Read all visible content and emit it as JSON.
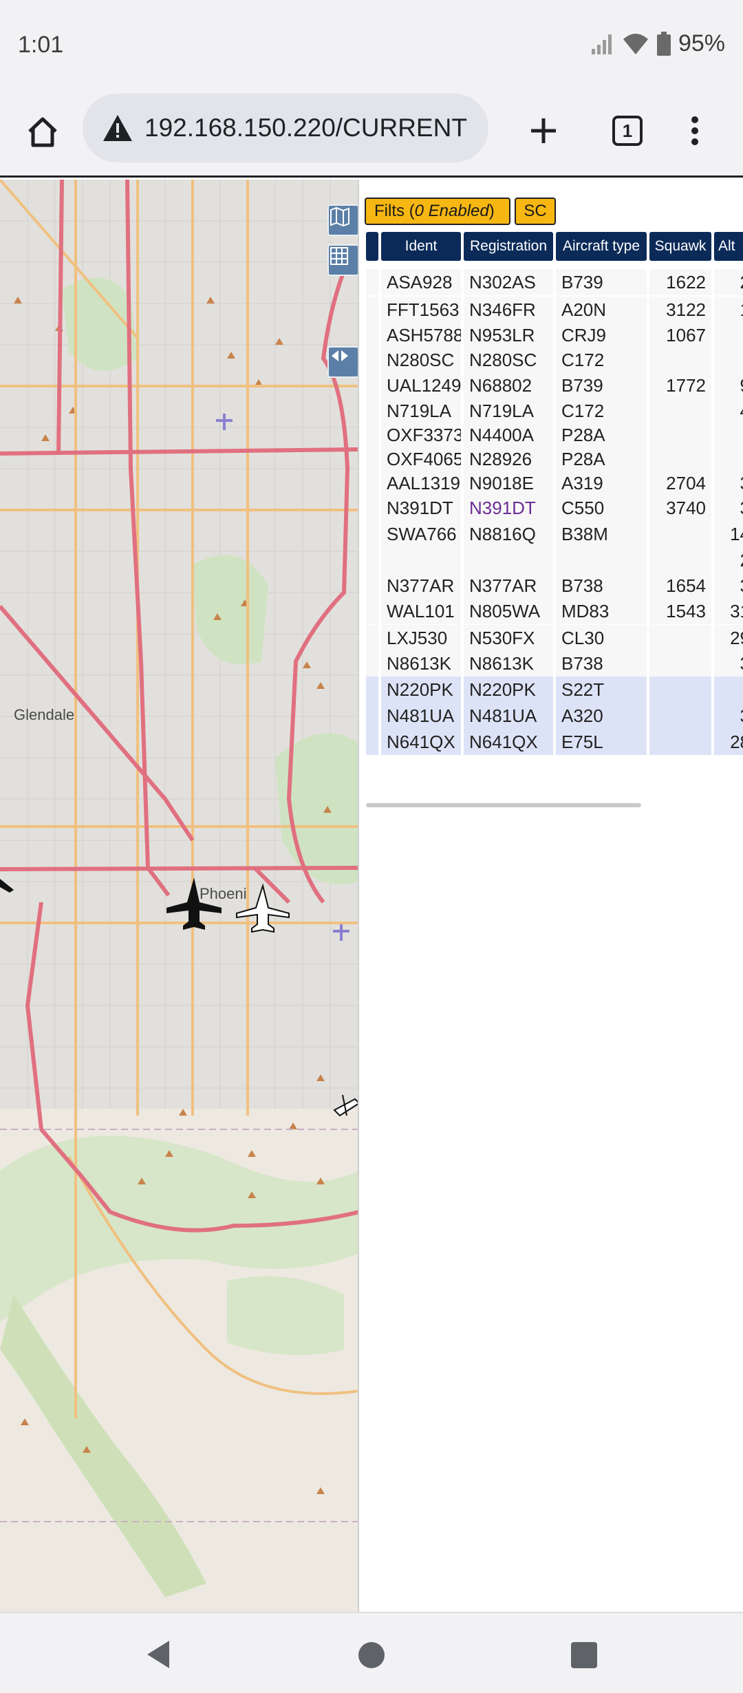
{
  "status": {
    "time": "1:01",
    "battery": "95%"
  },
  "browser": {
    "url": "192.168.150.220/CURRENT",
    "tab_count": "1"
  },
  "map": {
    "labels": {
      "glendale": "Glendale",
      "phoenix": "Phoeni"
    }
  },
  "filters": {
    "filter_label": "Filts (",
    "filter_enabled": "0 Enabled",
    "filter_close": ")",
    "sc_label": "SC"
  },
  "table": {
    "columns": [
      "Ident",
      "Registration",
      "Aircraft type",
      "Squawk",
      "Alt"
    ],
    "rows": [
      [
        "ASA928",
        "N302AS",
        "B739",
        "1622",
        "2"
      ],
      [
        "FFT1563",
        "N346FR",
        "A20N",
        "3122",
        "1"
      ],
      [
        "ASH5788",
        "N953LR",
        "CRJ9",
        "1067",
        ""
      ],
      [
        "N280SC",
        "N280SC",
        "C172",
        "",
        ""
      ],
      [
        "UAL1249",
        "N68802",
        "B739",
        "1772",
        "9"
      ],
      [
        "N719LA",
        "N719LA",
        "C172",
        "",
        "4"
      ],
      [
        "OXF3373",
        "N4400A",
        "P28A",
        "",
        ""
      ],
      [
        "OXF4065",
        "N28926",
        "P28A",
        "",
        ""
      ],
      [
        "AAL1319",
        "N9018E",
        "A319",
        "2704",
        "3"
      ],
      [
        "N391DT",
        "N391DT",
        "C550",
        "3740",
        "3"
      ],
      [
        "SWA766",
        "N8816Q",
        "B38M",
        "",
        "14"
      ],
      [
        "",
        "",
        "",
        "",
        "2"
      ],
      [
        "N377AR",
        "N377AR",
        "B738",
        "1654",
        "3"
      ],
      [
        "WAL101",
        "N805WA",
        "MD83",
        "1543",
        "31"
      ],
      [
        "LXJ530",
        "N530FX",
        "CL30",
        "",
        "29"
      ],
      [
        "N8613K",
        "N8613K",
        "B738",
        "",
        "3"
      ],
      [
        "N220PK",
        "N220PK",
        "S22T",
        "",
        ""
      ],
      [
        "N481UA",
        "N481UA",
        "A320",
        "",
        "3"
      ],
      [
        "N641QX",
        "N641QX",
        "E75L",
        "",
        "28"
      ]
    ]
  },
  "colors": {
    "header": "#0b2a58",
    "filter": "#f7b713",
    "selected_row": "#dde3f7",
    "link": "#6a2e96"
  }
}
